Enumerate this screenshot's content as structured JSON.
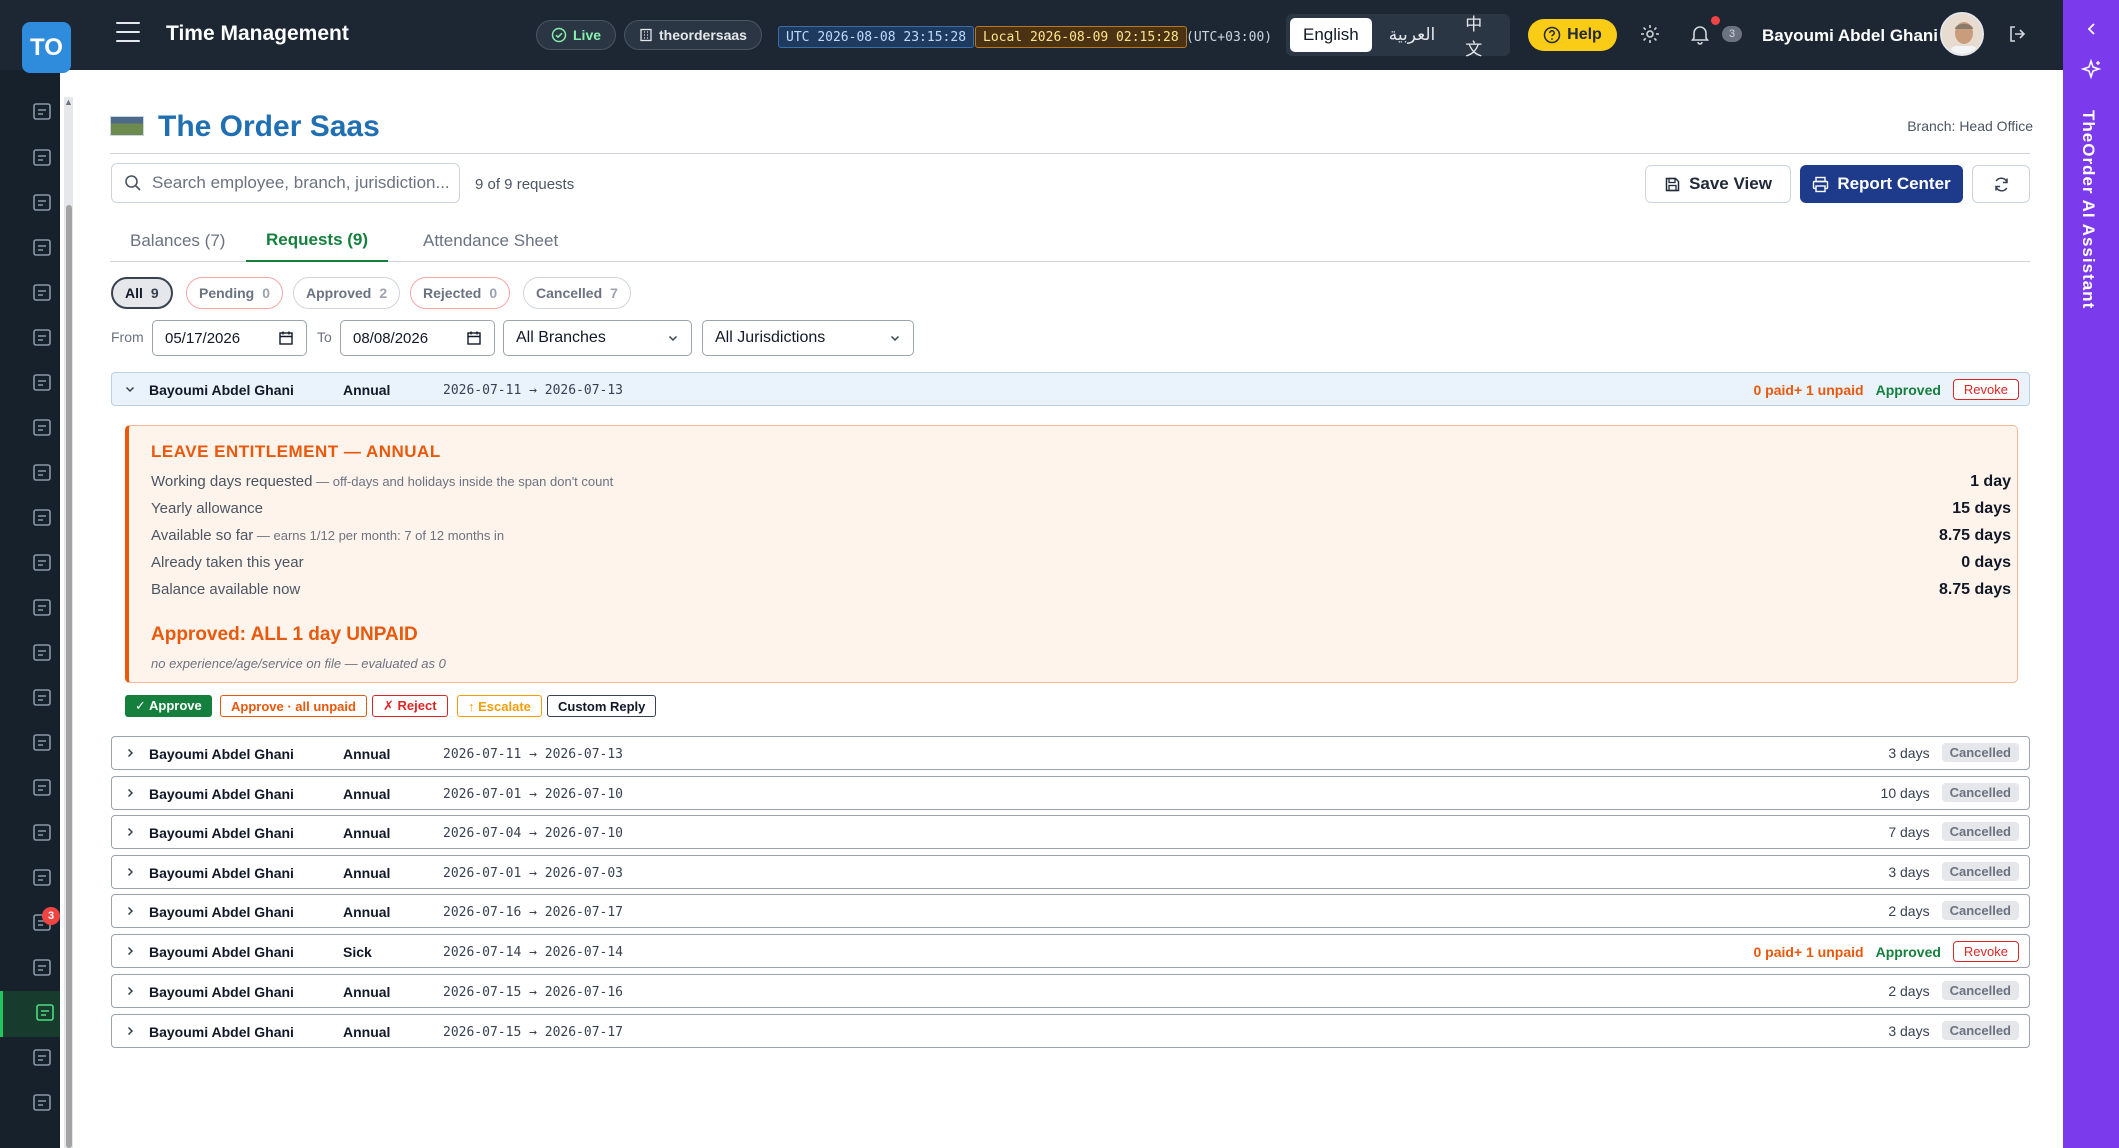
{
  "logo": {
    "text": "TO",
    "color": "#2f8bdc"
  },
  "header": {
    "title": "Time Management",
    "live_label": "Live",
    "tenant": "theordersaas",
    "utc_label": "UTC",
    "utc_time": "2026-08-08 23:15:28",
    "local_label": "Local",
    "local_time": "2026-08-09 02:15:28",
    "tz_offset": "(UTC+03:00)",
    "languages": [
      "English",
      "العربية",
      "中文"
    ],
    "active_language": "English",
    "help_label": "Help",
    "notification_count": "3",
    "user_name": "Bayoumi Abdel Ghani"
  },
  "sidebar": {
    "icons": [
      "cart-icon",
      "clipboard-check-icon",
      "archive-icon",
      "cube-icon",
      "layers-icon",
      "users-icon",
      "id-badge-icon",
      "person-icon",
      "ferry-icon",
      "receipt-icon",
      "wallet-icon",
      "bank-icon",
      "document-icon",
      "book-icon",
      "dollar-icon",
      "bar-chart-icon",
      "coins-icon",
      "inbox-icon",
      "send-icon",
      "team-icon",
      "calendar-clock-icon",
      "id-card-icon",
      "activity-icon"
    ],
    "active": "calendar-clock-icon",
    "send_badge": "3"
  },
  "ai_panel": {
    "label": "TheOrder AI Assistant",
    "color": "#7c3aed"
  },
  "org": {
    "name": "The Order Saas",
    "branch_label": "Branch: Head Office"
  },
  "toolbar": {
    "search_placeholder": "Search employee, branch, jurisdiction...",
    "request_count": "9 of 9 requests",
    "save_view": "Save View",
    "report_center": "Report Center"
  },
  "tabs": [
    {
      "label": "Balances (7)",
      "active": false
    },
    {
      "label": "Requests (9)",
      "active": true
    },
    {
      "label": "Attendance Sheet",
      "active": false
    }
  ],
  "filters": {
    "chips": [
      {
        "label": "All",
        "count": "9",
        "active": true
      },
      {
        "label": "Pending",
        "count": "0"
      },
      {
        "label": "Approved",
        "count": "2"
      },
      {
        "label": "Rejected",
        "count": "0"
      },
      {
        "label": "Cancelled",
        "count": "7"
      }
    ],
    "from_label": "From",
    "from_value": "05/17/2026",
    "to_label": "To",
    "to_value": "08/08/2026",
    "branch_select": "All Branches",
    "jurisdiction_select": "All Jurisdictions"
  },
  "expanded_request": {
    "employee": "Bayoumi Abdel Ghani",
    "type": "Annual",
    "range": "2026-07-11 → 2026-07-13",
    "paid_summary": "0 paid+ 1 unpaid",
    "status": "Approved",
    "revoke": "Revoke",
    "entitlement": {
      "title": "LEAVE ENTITLEMENT — ANNUAL",
      "lines": [
        {
          "label": "Working days requested",
          "note": " — off-days and holidays inside the span don't count",
          "value": "1 day"
        },
        {
          "label": "Yearly allowance",
          "note": "",
          "value": "15 days"
        },
        {
          "label": "Available so far",
          "note": " — earns 1/12 per month: 7 of 12 months in",
          "value": "8.75 days"
        },
        {
          "label": "Already taken this year",
          "note": "",
          "value": "0 days"
        },
        {
          "label": "Balance available now",
          "note": "",
          "value": "8.75 days"
        }
      ],
      "verdict": "Approved: ALL 1 day UNPAID",
      "footnote": "no experience/age/service on file — evaluated as 0"
    },
    "actions": {
      "approve": "✓ Approve",
      "approve_unpaid": "Approve · all unpaid",
      "reject": "✗ Reject",
      "escalate": "↑ Escalate",
      "custom_reply": "Custom Reply"
    }
  },
  "requests": [
    {
      "employee": "Bayoumi Abdel Ghani",
      "type": "Annual",
      "range": "2026-07-11 → 2026-07-13",
      "days": "3 days",
      "status": "Cancelled"
    },
    {
      "employee": "Bayoumi Abdel Ghani",
      "type": "Annual",
      "range": "2026-07-01 → 2026-07-10",
      "days": "10 days",
      "status": "Cancelled"
    },
    {
      "employee": "Bayoumi Abdel Ghani",
      "type": "Annual",
      "range": "2026-07-04 → 2026-07-10",
      "days": "7 days",
      "status": "Cancelled"
    },
    {
      "employee": "Bayoumi Abdel Ghani",
      "type": "Annual",
      "range": "2026-07-01 → 2026-07-03",
      "days": "3 days",
      "status": "Cancelled"
    },
    {
      "employee": "Bayoumi Abdel Ghani",
      "type": "Annual",
      "range": "2026-07-16 → 2026-07-17",
      "days": "2 days",
      "status": "Cancelled"
    },
    {
      "employee": "Bayoumi Abdel Ghani",
      "type": "Sick",
      "range": "2026-07-14 → 2026-07-14",
      "paid_summary": "0 paid+ 1 unpaid",
      "status": "Approved",
      "revoke": "Revoke"
    },
    {
      "employee": "Bayoumi Abdel Ghani",
      "type": "Annual",
      "range": "2026-07-15 → 2026-07-16",
      "days": "2 days",
      "status": "Cancelled"
    },
    {
      "employee": "Bayoumi Abdel Ghani",
      "type": "Annual",
      "range": "2026-07-15 → 2026-07-17",
      "days": "3 days",
      "status": "Cancelled"
    }
  ]
}
